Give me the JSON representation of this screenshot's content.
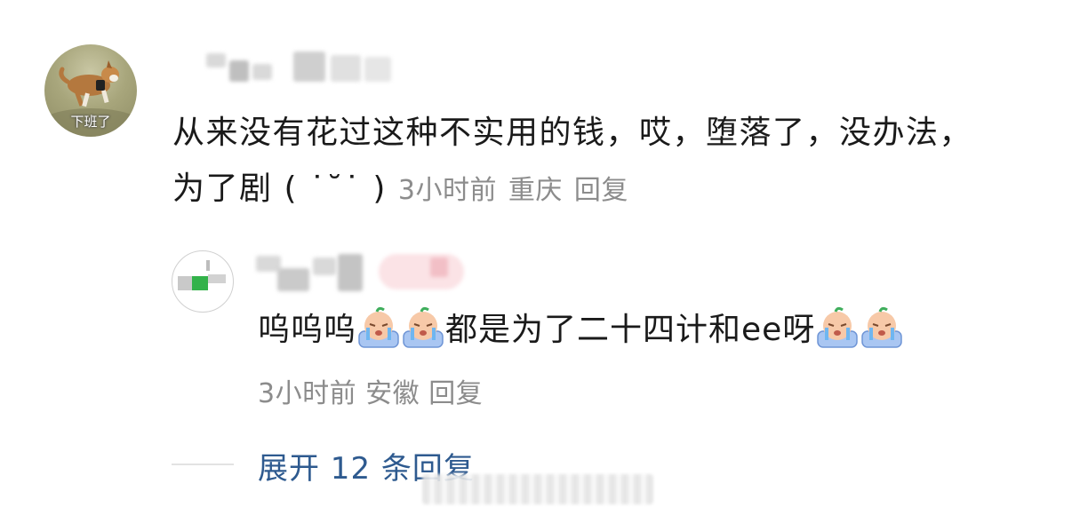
{
  "comment": {
    "avatar_caption": "下班了",
    "text": "从来没有花过这种不实用的钱，哎，堕落了，没办法，为了剧 ( ˙˘˙ )",
    "time": "3小时前",
    "location": "重庆",
    "reply_label": "回复"
  },
  "reply": {
    "text_part1": "呜呜呜",
    "text_part2": "都是为了二十四计和ee呀",
    "emoji_name": "crying-face-emoji",
    "time": "3小时前",
    "location": "安徽",
    "reply_label": "回复"
  },
  "expand": {
    "label": "展开 12 条回复"
  },
  "colors": {
    "meta": "#8c8c8c",
    "link": "#2e5a8f",
    "text": "#1a1a1a"
  }
}
